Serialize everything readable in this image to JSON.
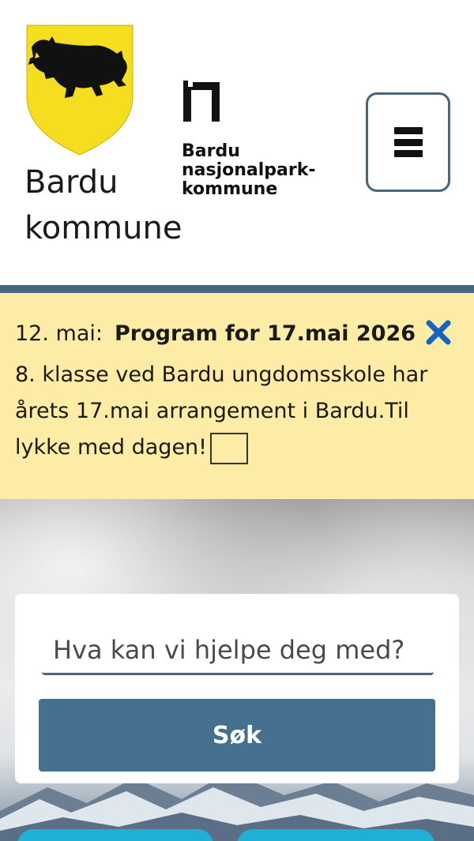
{
  "header": {
    "municipality_name": "Bardu kommune",
    "national_park_logo": {
      "line1": "Bardu",
      "line2": "nasjonalpark-",
      "line3": "kommune"
    },
    "menu_icon": "hamburger-menu-icon"
  },
  "notice": {
    "date": "12. mai:",
    "title": "Program for 17.mai 2026",
    "body": "8. klasse ved Bardu ungdomsskole har årets 17.mai arrangement i Bardu.Til lykke med dagen!",
    "close_icon": "close-x-icon"
  },
  "search": {
    "placeholder": "Hva kan vi hjelpe deg med?",
    "button_label": "Søk"
  },
  "colors": {
    "accent": "#46667f",
    "button": "#46708f",
    "notice_bg": "#fdeca6",
    "crest_yellow": "#f5de1f",
    "close_blue": "#1565c0",
    "quick_link": "#1fb0d6"
  }
}
